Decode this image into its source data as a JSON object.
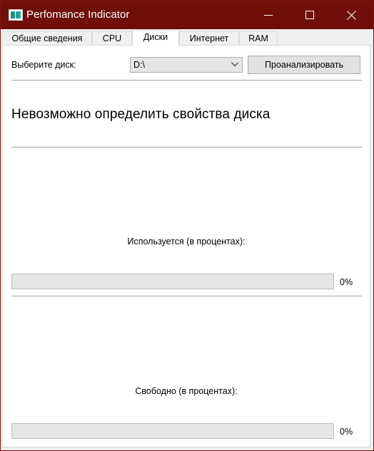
{
  "window": {
    "title": "Perfomance Indicator"
  },
  "tabs": [
    "Общие сведения",
    "CPU",
    "Диски",
    "Интернет",
    "RAM"
  ],
  "active_tab_index": 2,
  "disk": {
    "select_label": "Выберите диск:",
    "selected_drive": "D:\\",
    "analyze_button": "Проанализировать",
    "status_message": "Невозможно определить свойства диска"
  },
  "usage": {
    "used_label": "Используется (в процентах):",
    "used_value": 0,
    "used_text": "0%",
    "free_label": "Свободно (в процентах):",
    "free_value": 0,
    "free_text": "0%"
  },
  "icons": {
    "app": "app-icon",
    "minimize": "minimize-icon",
    "maximize": "maximize-icon",
    "close": "close-icon",
    "dropdown": "chevron-down-icon"
  },
  "colors": {
    "titlebar": "#6f0f0a",
    "progress_fill": "#06b025"
  }
}
